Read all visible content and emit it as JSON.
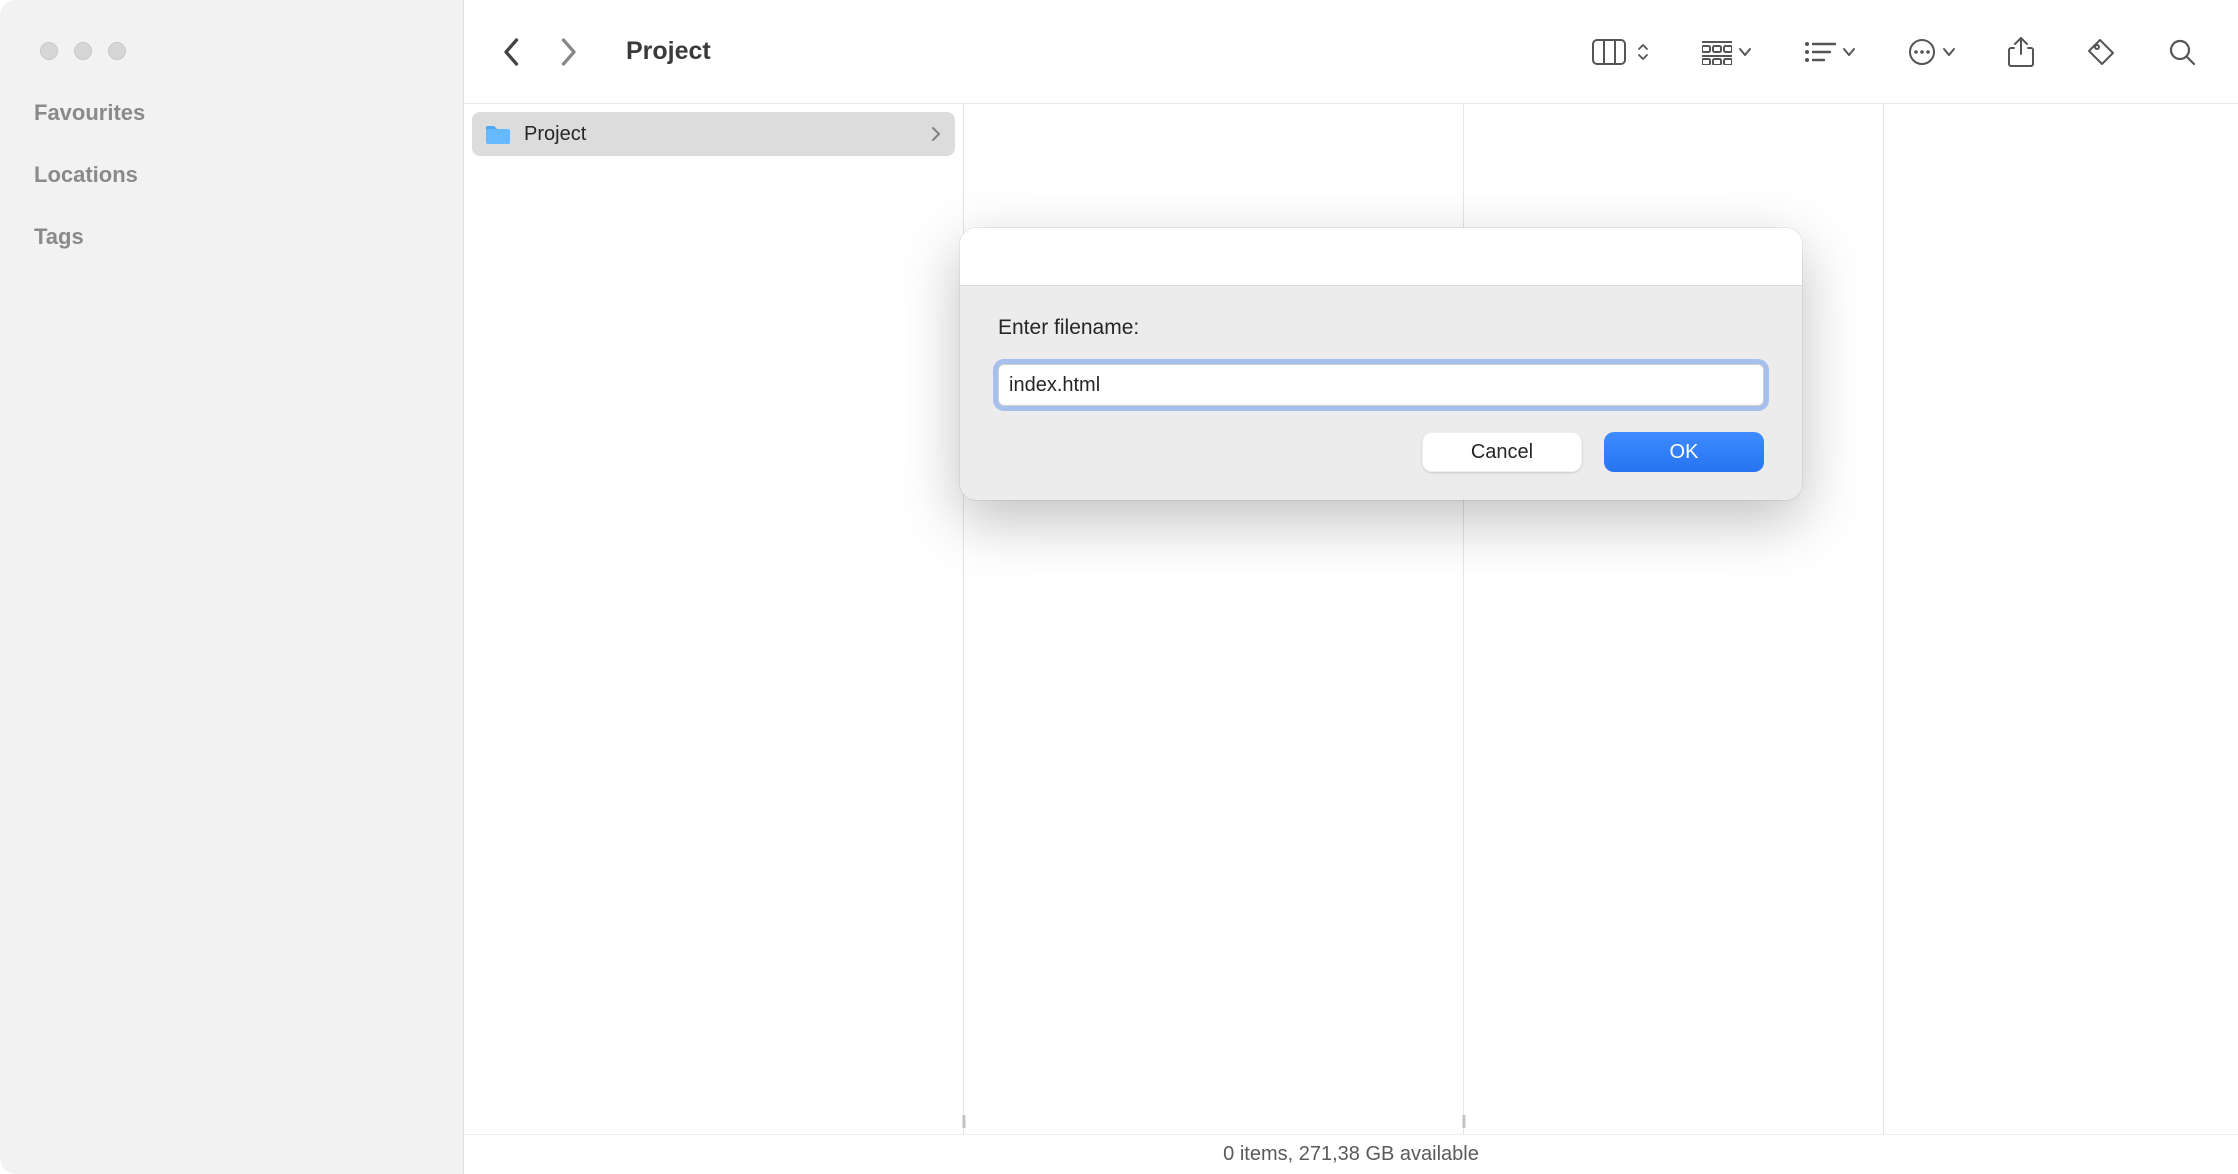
{
  "sidebar": {
    "sections": [
      "Favourites",
      "Locations",
      "Tags"
    ]
  },
  "toolbar": {
    "title": "Project"
  },
  "columns": [
    {
      "items": [
        {
          "name": "Project",
          "type": "folder",
          "selected": true
        }
      ]
    },
    {
      "items": []
    },
    {
      "items": []
    },
    {
      "items": []
    }
  ],
  "status": "0 items, 271,38 GB available",
  "dialog": {
    "prompt": "Enter filename:",
    "value": "index.html",
    "cancel_label": "Cancel",
    "ok_label": "OK"
  }
}
